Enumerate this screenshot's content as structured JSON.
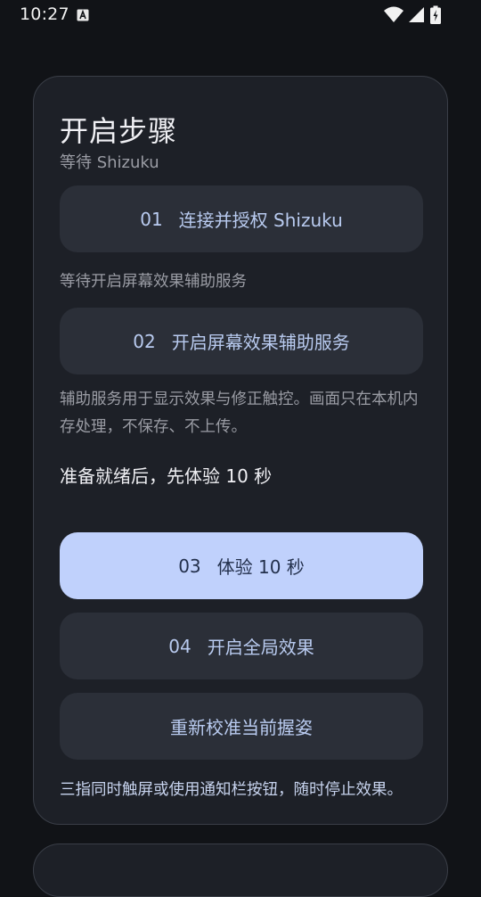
{
  "status_bar": {
    "time": "10:27",
    "notification_icon": "a-letter-icon",
    "icons": [
      "wifi-icon",
      "signal-icon",
      "battery-charging-icon"
    ]
  },
  "card": {
    "title": "开启步骤",
    "subtitle": "等待 Shizuku",
    "step1": {
      "num": "01",
      "label": "连接并授权 Shizuku"
    },
    "wait_accessibility": "等待开启屏幕效果辅助服务",
    "step2": {
      "num": "02",
      "label": "开启屏幕效果辅助服务"
    },
    "accessibility_note": "辅助服务用于显示效果与修正触控。画面只在本机内存处理，不保存、不上传。",
    "ready_text": "准备就绪后，先体验 10 秒",
    "step3": {
      "num": "03",
      "label": "体验 10 秒"
    },
    "step4": {
      "num": "04",
      "label": "开启全局效果"
    },
    "recalibrate": {
      "label": "重新校准当前握姿"
    },
    "stop_hint": "三指同时触屏或使用通知栏按钮，随时停止效果。"
  },
  "colors": {
    "background": "#111317",
    "card": "#1d2027",
    "button": "#2b2f38",
    "button_text": "#b9cbf0",
    "primary_button": "#c0d1fc",
    "primary_text": "#23304c"
  }
}
